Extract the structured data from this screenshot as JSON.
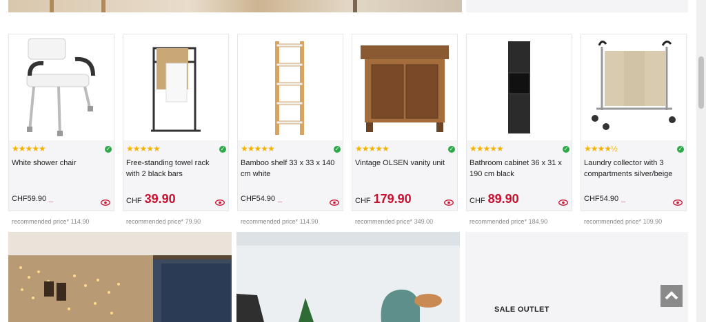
{
  "products": [
    {
      "name": "White shower chair",
      "rating": "★★★★★",
      "rec_label": "recommended price*",
      "rec_price": "114.90",
      "currency": "CHF",
      "price": "59.90",
      "big": false
    },
    {
      "name": "Free-standing towel rack with 2 black bars",
      "rating": "★★★★★",
      "rec_label": "recommended price*",
      "rec_price": "79.90",
      "currency": "CHF",
      "price": "39.90",
      "big": true
    },
    {
      "name": "Bamboo shelf 33 x 33 x 140 cm white",
      "rating": "★★★★★",
      "rec_label": "recommended price*",
      "rec_price": "114.90",
      "currency": "CHF",
      "price": "54.90",
      "big": false
    },
    {
      "name": "Vintage OLSEN vanity unit",
      "rating": "★★★★★",
      "rec_label": "recommended price*",
      "rec_price": "349.00",
      "currency": "CHF",
      "price": "179.90",
      "big": true
    },
    {
      "name": "Bathroom cabinet 36 x 31 x 190 cm black",
      "rating": "★★★★★",
      "rec_label": "recommended price*",
      "rec_price": "184.90",
      "currency": "CHF",
      "price": "89.90",
      "big": true
    },
    {
      "name": "Laundry collector with 3 compartments silver/beige",
      "rating": "★★★★½",
      "rec_label": "recommended price*",
      "rec_price": "109.90",
      "currency": "CHF",
      "price": "54.90",
      "big": false
    }
  ],
  "sale": {
    "label": "SALE OUTLET"
  },
  "colors": {
    "accent": "#c8102e",
    "star": "#f5b301",
    "check": "#2ea84a",
    "panel": "#f5f5f7"
  },
  "icons": {
    "availability": "check-circle-icon",
    "view": "eye-icon",
    "scroll": "chevron-up-icon"
  }
}
